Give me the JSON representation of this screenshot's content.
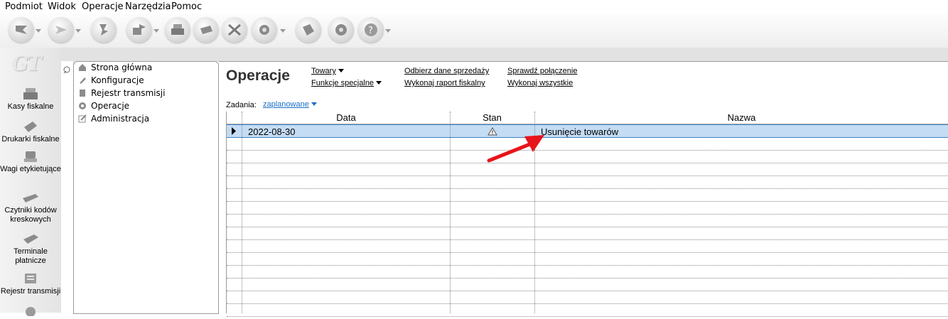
{
  "menu": [
    "Podmiot",
    "Widok",
    "Operacje",
    "Narzędzia",
    "Pomoc"
  ],
  "toolbar_icons": [
    "back-icon",
    "forward-icon",
    "connect-icon",
    "share-icon",
    "cash-register-icon",
    "printer-icon",
    "scissors-icon",
    "tools-icon",
    "label-icon",
    "settings-icon",
    "help-icon"
  ],
  "modules": [
    {
      "label": "Kasy fiskalne",
      "icon": "cash-register-icon"
    },
    {
      "label": "Drukarki fiskalne",
      "icon": "fiscal-printer-icon"
    },
    {
      "label": "Wagi etykietujące",
      "icon": "scale-icon"
    },
    {
      "label": "Czytniki kodów kreskowych",
      "icon": "barcode-scanner-icon"
    },
    {
      "label": "Terminale płatnicze",
      "icon": "payment-terminal-icon"
    },
    {
      "label": "Rejestr transmisji",
      "icon": "transmission-log-icon"
    }
  ],
  "nav": {
    "items": [
      {
        "label": "Strona główna",
        "icon": "home-icon"
      },
      {
        "label": "Konfiguracje",
        "icon": "config-icon"
      },
      {
        "label": "Rejestr transmisji",
        "icon": "transmission-icon"
      },
      {
        "label": "Operacje",
        "icon": "gear-icon"
      },
      {
        "label": "Administracja",
        "icon": "admin-icon"
      }
    ]
  },
  "page": {
    "title": "Operacje",
    "links": {
      "towary": "Towary",
      "funkcje": "Funkcje specjalne",
      "odbierz": "Odbierz dane sprzedaży",
      "raport": "Wykonaj raport fiskalny",
      "sprawdz": "Sprawdź połączenie",
      "wszystkie": "Wykonaj wszystkie"
    },
    "zadania_label": "Zadania:",
    "zadania_value": "zaplanowane"
  },
  "grid": {
    "columns": [
      "Data",
      "Stan",
      "Nazwa"
    ],
    "rows": [
      {
        "data": "2022-08-30",
        "stan": "warning-icon",
        "nazwa": "Usunięcie towarów"
      }
    ]
  },
  "colors": {
    "selection": "#c4dcf4",
    "annotation_arrow": "#e8141b",
    "link_blue": "#1a6fc9"
  }
}
